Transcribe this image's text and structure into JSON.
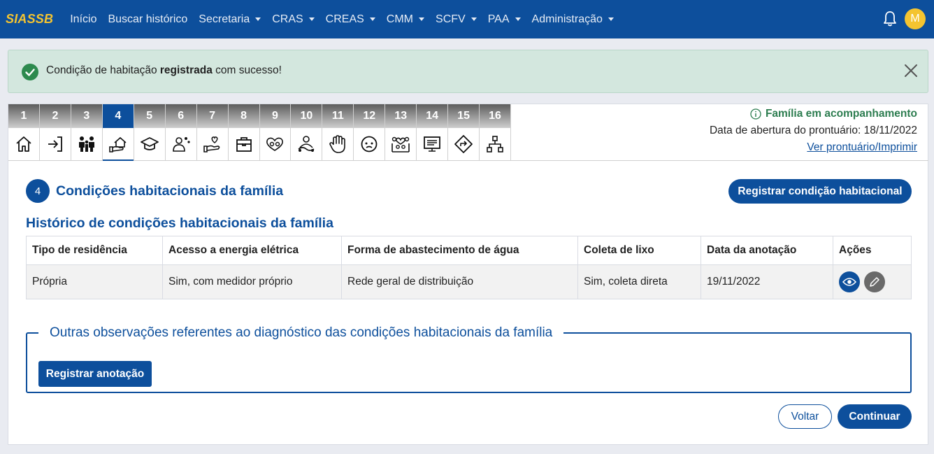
{
  "navbar": {
    "brand": "SIASSB",
    "items": [
      {
        "label": "Início",
        "dropdown": false
      },
      {
        "label": "Buscar histórico",
        "dropdown": false
      },
      {
        "label": "Secretaria",
        "dropdown": true
      },
      {
        "label": "CRAS",
        "dropdown": true
      },
      {
        "label": "CREAS",
        "dropdown": true
      },
      {
        "label": "CMM",
        "dropdown": true
      },
      {
        "label": "SCFV",
        "dropdown": true
      },
      {
        "label": "PAA",
        "dropdown": true
      },
      {
        "label": "Administração",
        "dropdown": true
      }
    ],
    "avatar_initial": "M"
  },
  "alert": {
    "text_before": "Condição de habitação ",
    "text_bold": "registrada",
    "text_after": " com sucesso!"
  },
  "tabs": [
    {
      "num": "1",
      "icon": "home-icon"
    },
    {
      "num": "2",
      "icon": "login-icon"
    },
    {
      "num": "3",
      "icon": "family-icon"
    },
    {
      "num": "4",
      "icon": "housing-hand-icon",
      "active": true
    },
    {
      "num": "5",
      "icon": "graduation-cap-icon"
    },
    {
      "num": "6",
      "icon": "health-worker-icon"
    },
    {
      "num": "7",
      "icon": "heart-hand-icon"
    },
    {
      "num": "8",
      "icon": "briefcase-icon"
    },
    {
      "num": "9",
      "icon": "group-heart-icon"
    },
    {
      "num": "10",
      "icon": "sick-person-icon"
    },
    {
      "num": "11",
      "icon": "hand-stop-icon"
    },
    {
      "num": "12",
      "icon": "face-icon"
    },
    {
      "num": "13",
      "icon": "community-heart-icon"
    },
    {
      "num": "14",
      "icon": "presentation-icon"
    },
    {
      "num": "15",
      "icon": "direction-sign-icon"
    },
    {
      "num": "16",
      "icon": "hierarchy-icon"
    }
  ],
  "status": {
    "label": "Família em acompanhamento",
    "opening_date": "Data de abertura do prontuário: 18/11/2022",
    "link": "Ver prontuário/Imprimir"
  },
  "step": {
    "number": "4",
    "title": "Condições habitacionais da família",
    "register_button": "Registrar condição habitacional"
  },
  "history": {
    "title": "Histórico de condições habitacionais da família",
    "columns": [
      "Tipo de residência",
      "Acesso a energia elétrica",
      "Forma de abastecimento de água",
      "Coleta de lixo",
      "Data da anotação",
      "Ações"
    ],
    "rows": [
      [
        "Própria",
        "Sim, com medidor próprio",
        "Rede geral de distribuição",
        "Sim, coleta direta",
        "19/11/2022"
      ]
    ]
  },
  "observations": {
    "legend": "Outras observações referentes ao diagnóstico das condições habitacionais da família",
    "button": "Registrar anotação"
  },
  "footer": {
    "back": "Voltar",
    "next": "Continuar"
  },
  "colors": {
    "primary": "#0d4f9c",
    "brand_yellow": "#f4c430",
    "success_bg": "#d3e7de",
    "success_green": "#2d7d50"
  }
}
